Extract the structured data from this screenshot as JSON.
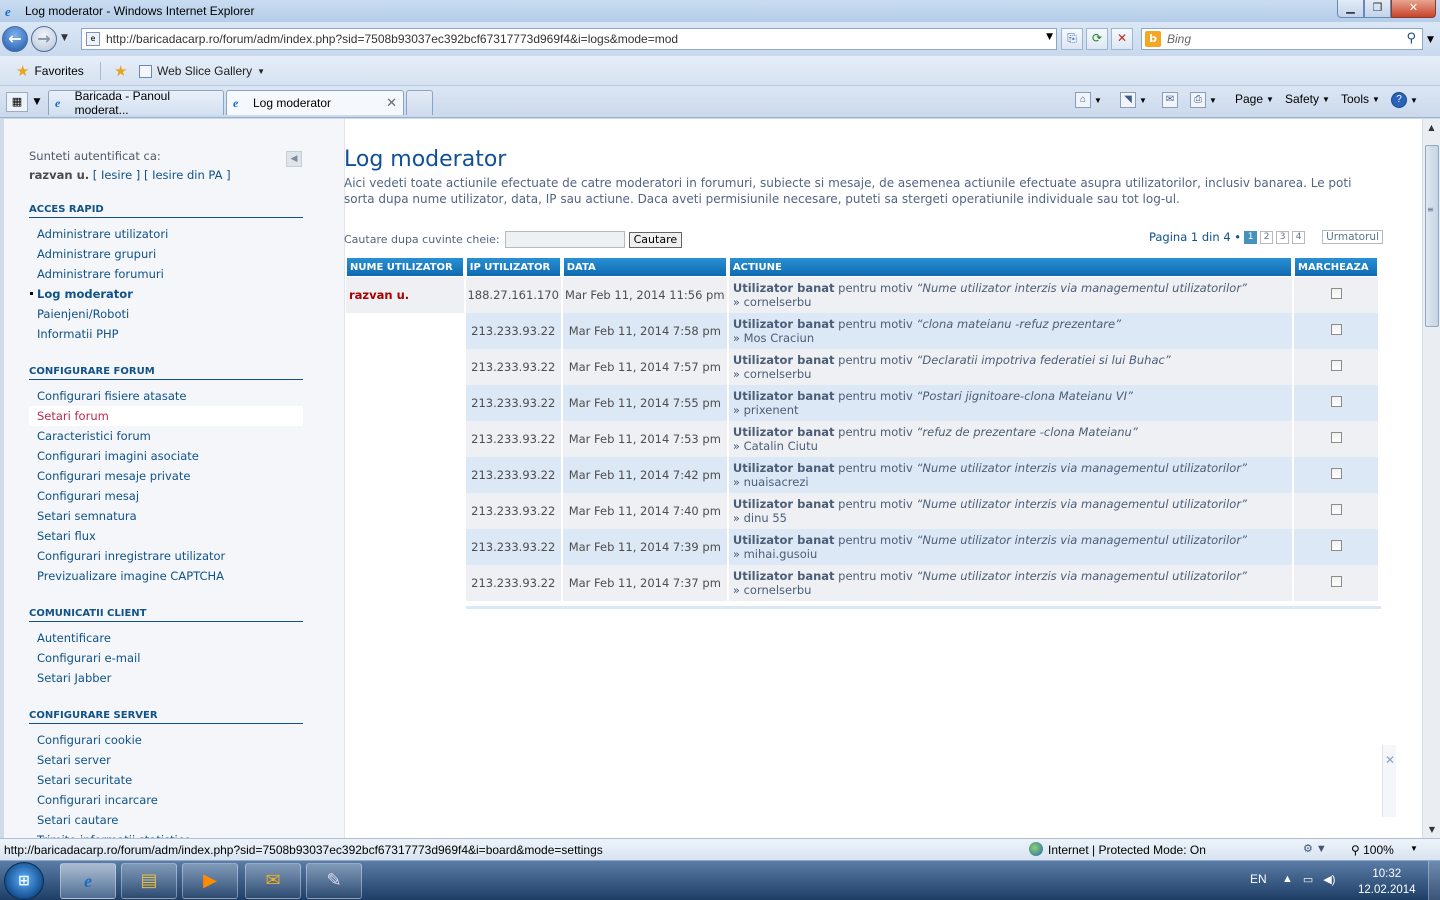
{
  "window": {
    "title": "Log moderator - Windows Internet Explorer",
    "controls": [
      "minimize",
      "maximize",
      "close"
    ]
  },
  "address_bar": {
    "url": "http://baricadacarp.ro/forum/adm/index.php?sid=7508b93037ec392bcf67317773d969f4&i=logs&mode=mod",
    "search_placeholder": "Bing"
  },
  "favorites_bar": {
    "favorites_label": "Favorites",
    "web_slice_label": "Web Slice Gallery"
  },
  "tabs": [
    {
      "label": "Baricada - Panoul moderat...",
      "active": false
    },
    {
      "label": "Log moderator",
      "active": true
    }
  ],
  "command_bar": {
    "page_label": "Page",
    "safety_label": "Safety",
    "tools_label": "Tools"
  },
  "sidebar": {
    "auth_label": "Sunteti autentificat ca:",
    "auth_user": "razvan u.",
    "auth_links": [
      "[ Iesire ]",
      "[ Iesire din PA ]"
    ],
    "sections": [
      {
        "title": "ACCES RAPID",
        "items": [
          "Administrare utilizatori",
          "Administrare grupuri",
          "Administrare forumuri",
          "Log moderator",
          "Paienjeni/Roboti",
          "Informatii PHP"
        ]
      },
      {
        "title": "CONFIGURARE FORUM",
        "items": [
          "Configurari fisiere atasate",
          "Setari forum",
          "Caracteristici forum",
          "Configurari imagini asociate",
          "Configurari mesaje private",
          "Configurari mesaj",
          "Setari semnatura",
          "Setari flux",
          "Configurari inregistrare utilizator",
          "Previzualizare imagine CAPTCHA"
        ]
      },
      {
        "title": "COMUNICATII CLIENT",
        "items": [
          "Autentificare",
          "Configurari e-mail",
          "Setari Jabber"
        ]
      },
      {
        "title": "CONFIGURARE SERVER",
        "items": [
          "Configurari cookie",
          "Setari server",
          "Setari securitate",
          "Configurari incarcare",
          "Setari cautare",
          "Trimite informatii statistice"
        ]
      }
    ],
    "active_item": "Log moderator",
    "hover_item": "Setari forum"
  },
  "main": {
    "title": "Log moderator",
    "intro": "Aici vedeti toate actiunile efectuate de catre moderatori in forumuri, subiecte si mesaje, de asemenea actiunile efectuate asupra utilizatorilor, inclusiv banarea. Le poti sorta dupa nume utilizator, data, IP sau actiune. Daca aveti permisiunile necesare, puteti sa stergeti operatiunile individuale sau tot log-ul.",
    "search_label": "Cautare dupa cuvinte cheie:",
    "search_value": "",
    "search_button": "Cautare",
    "pagination": {
      "label": "Pagina 1 din 4 •",
      "pages": [
        "1",
        "2",
        "3",
        "4"
      ],
      "current": "1",
      "next": "Urmatorul"
    },
    "table": {
      "headers": [
        "NUME UTILIZATOR",
        "IP UTILIZATOR",
        "DATA",
        "ACTIUNE",
        "MARCHEAZA"
      ],
      "rows": [
        {
          "user": "razvan u.",
          "ip": "188.27.161.170",
          "date": "Mar Feb 11, 2014 11:56 pm",
          "action": "Utilizator banat",
          "mid": " pentru motiv ",
          "reason": "“Nume utilizator interzis via managementul utilizatorilor”",
          "target": "» cornelserbu"
        },
        {
          "user": "",
          "ip": "213.233.93.22",
          "date": "Mar Feb 11, 2014 7:58 pm",
          "action": "Utilizator banat",
          "mid": " pentru motiv ",
          "reason": "“clona mateianu -refuz prezentare”",
          "target": "» Mos Craciun"
        },
        {
          "user": "",
          "ip": "213.233.93.22",
          "date": "Mar Feb 11, 2014 7:57 pm",
          "action": "Utilizator banat",
          "mid": " pentru motiv ",
          "reason": "“Declaratii impotriva federatiei si lui Buhac”",
          "target": "» cornelserbu"
        },
        {
          "user": "",
          "ip": "213.233.93.22",
          "date": "Mar Feb 11, 2014 7:55 pm",
          "action": "Utilizator banat",
          "mid": " pentru motiv ",
          "reason": "“Postari jignitoare-clona Mateianu VI”",
          "target": "» prixenent"
        },
        {
          "user": "",
          "ip": "213.233.93.22",
          "date": "Mar Feb 11, 2014 7:53 pm",
          "action": "Utilizator banat",
          "mid": " pentru motiv ",
          "reason": "“refuz de prezentare -clona Mateianu”",
          "target": "» Catalin Ciutu"
        },
        {
          "user": "",
          "ip": "213.233.93.22",
          "date": "Mar Feb 11, 2014 7:42 pm",
          "action": "Utilizator banat",
          "mid": " pentru motiv ",
          "reason": "“Nume utilizator interzis via managementul utilizatorilor”",
          "target": "» nuaisacrezi"
        },
        {
          "user": "",
          "ip": "213.233.93.22",
          "date": "Mar Feb 11, 2014 7:40 pm",
          "action": "Utilizator banat",
          "mid": " pentru motiv ",
          "reason": "“Nume utilizator interzis via managementul utilizatorilor”",
          "target": "» dinu 55"
        },
        {
          "user": "",
          "ip": "213.233.93.22",
          "date": "Mar Feb 11, 2014 7:39 pm",
          "action": "Utilizator banat",
          "mid": " pentru motiv ",
          "reason": "“Nume utilizator interzis via managementul utilizatorilor”",
          "target": "» mihai.gusoiu"
        },
        {
          "user": "",
          "ip": "213.233.93.22",
          "date": "Mar Feb 11, 2014 7:37 pm",
          "action": "Utilizator banat",
          "mid": " pentru motiv ",
          "reason": "“Nume utilizator interzis via managementul utilizatorilor”",
          "target": "» cornelserbu"
        }
      ]
    }
  },
  "status_bar": {
    "url": "http://baricadacarp.ro/forum/adm/index.php?sid=7508b93037ec392bcf67317773d969f4&i=board&mode=settings",
    "zone": "Internet | Protected Mode: On",
    "zoom": "100%"
  },
  "taskbar": {
    "language": "EN",
    "time": "10:32",
    "date": "12.02.2014"
  },
  "colors": {
    "accent": "#105289",
    "header_blue": "#1176be",
    "row_alt": "#dce8f5",
    "user_red": "#aa0000"
  }
}
